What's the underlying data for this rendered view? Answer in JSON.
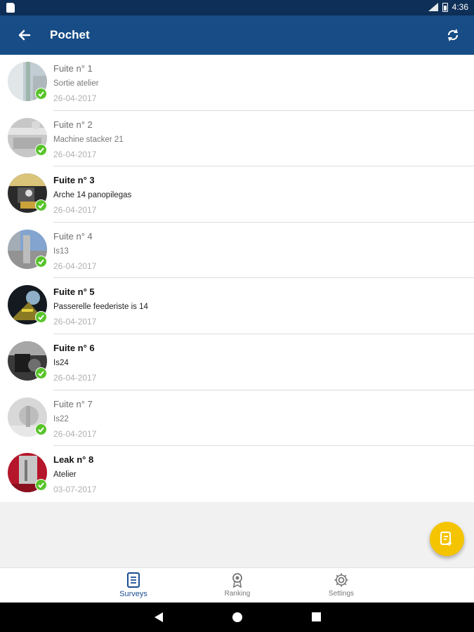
{
  "status_bar": {
    "time": "4:36"
  },
  "app_bar": {
    "title": "Pochet"
  },
  "items": [
    {
      "title": "Fuite n° 1",
      "subtitle": "Sortie atelier",
      "date": "26-04-2017",
      "read": true
    },
    {
      "title": "Fuite n° 2",
      "subtitle": "Machine stacker 21",
      "date": "26-04-2017",
      "read": true
    },
    {
      "title": "Fuite n° 3",
      "subtitle": "Arche 14 panopilegas",
      "date": "26-04-2017",
      "read": false
    },
    {
      "title": "Fuite n° 4",
      "subtitle": "Is13",
      "date": "26-04-2017",
      "read": true
    },
    {
      "title": "Fuite n° 5",
      "subtitle": "Passerelle feederiste is 14",
      "date": "26-04-2017",
      "read": false
    },
    {
      "title": "Fuite n° 6",
      "subtitle": "Is24",
      "date": "26-04-2017",
      "read": false
    },
    {
      "title": "Fuite n° 7",
      "subtitle": "Is22",
      "date": "26-04-2017",
      "read": true
    },
    {
      "title": "Leak n° 8",
      "subtitle": "Atelier",
      "date": "03-07-2017",
      "read": false
    }
  ],
  "bottom_nav": [
    {
      "label": "Surveys",
      "icon": "list-document-icon",
      "active": true
    },
    {
      "label": "Ranking",
      "icon": "award-ribbon-icon",
      "active": false
    },
    {
      "label": "Settings",
      "icon": "gear-icon",
      "active": false
    }
  ],
  "colors": {
    "app_bar": "#174c86",
    "status_bar": "#0e2f57",
    "fab": "#f5c400",
    "check": "#58c42a",
    "active_nav": "#1b4c92"
  }
}
